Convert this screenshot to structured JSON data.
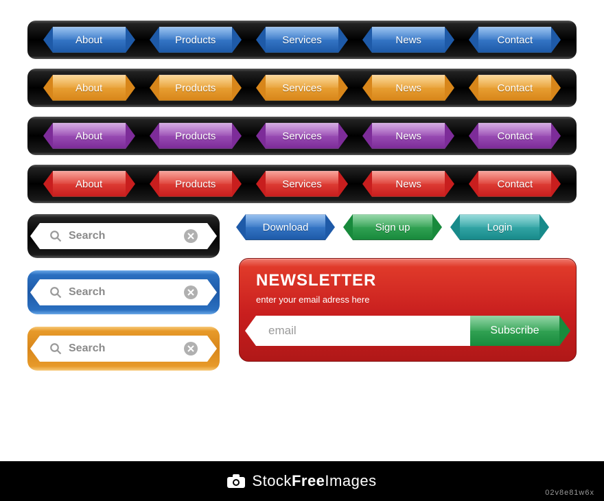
{
  "nav_items": [
    "About",
    "Products",
    "Services",
    "News",
    "Contact"
  ],
  "action_buttons": {
    "download": "Download",
    "signup": "Sign up",
    "login": "Login"
  },
  "search": {
    "placeholder": "Search"
  },
  "newsletter": {
    "title": "NEWSLETTER",
    "subtitle": "enter your email adress here",
    "placeholder": "email",
    "subscribe": "Subscribe"
  },
  "footer": {
    "brand_light": "Stock",
    "brand_bold": "Free",
    "brand_light2": "Images",
    "id": "02v8e81w6x"
  },
  "colors": {
    "blue": "#1e5aa8",
    "orange": "#d8861a",
    "purple": "#7d2c99",
    "red": "#c81e1e",
    "green": "#188a3c",
    "teal": "#188a8a"
  }
}
